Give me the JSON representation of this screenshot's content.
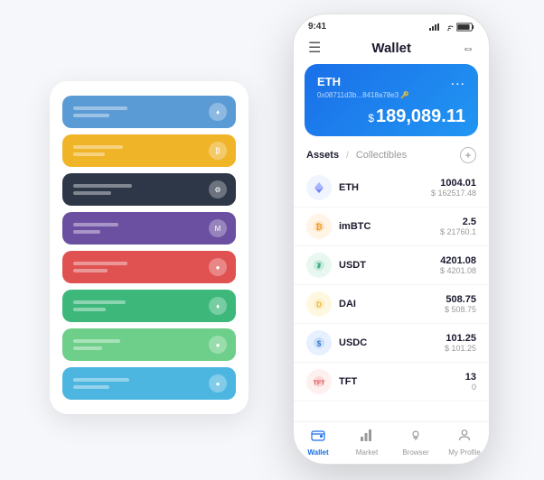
{
  "app": {
    "title": "Wallet",
    "time": "9:41"
  },
  "phone": {
    "status_bar": {
      "time": "9:41",
      "signal": "●●●",
      "wifi": "WiFi",
      "battery": "Battery"
    },
    "header": {
      "title": "Wallet",
      "menu_icon": "☰",
      "scan_icon": "⇔"
    },
    "eth_card": {
      "label": "ETH",
      "dots": "...",
      "address": "0x08711d3b...8418a78e3 🔑",
      "currency_symbol": "$",
      "balance": "189,089.11"
    },
    "assets_section": {
      "tab_active": "Assets",
      "tab_divider": "/",
      "tab_inactive": "Collectibles",
      "add_label": "+"
    },
    "assets": [
      {
        "name": "ETH",
        "icon": "♦",
        "amount": "1004.01",
        "usd": "$ 162517.48",
        "icon_class": "eth-icon"
      },
      {
        "name": "imBTC",
        "icon": "₿",
        "amount": "2.5",
        "usd": "$ 21760.1",
        "icon_class": "imbtc-icon"
      },
      {
        "name": "USDT",
        "icon": "₮",
        "amount": "4201.08",
        "usd": "$ 4201.08",
        "icon_class": "usdt-icon"
      },
      {
        "name": "DAI",
        "icon": "⬡",
        "amount": "508.75",
        "usd": "$ 508.75",
        "icon_class": "dai-icon"
      },
      {
        "name": "USDC",
        "icon": "$",
        "amount": "101.25",
        "usd": "$ 101.25",
        "icon_class": "usdc-icon"
      },
      {
        "name": "TFT",
        "icon": "🌿",
        "amount": "13",
        "usd": "0",
        "icon_class": "tft-icon"
      }
    ],
    "bottom_nav": [
      {
        "label": "Wallet",
        "icon": "◎",
        "active": true
      },
      {
        "label": "Market",
        "icon": "📊",
        "active": false
      },
      {
        "label": "Browser",
        "icon": "👤",
        "active": false
      },
      {
        "label": "My Profile",
        "icon": "👤",
        "active": false
      }
    ]
  },
  "card_stack": {
    "cards": [
      {
        "color": "card-blue",
        "dot": "♦"
      },
      {
        "color": "card-yellow",
        "dot": "₿"
      },
      {
        "color": "card-dark",
        "dot": "⚙"
      },
      {
        "color": "card-purple",
        "dot": "M"
      },
      {
        "color": "card-red",
        "dot": "●"
      },
      {
        "color": "card-green",
        "dot": "♦"
      },
      {
        "color": "card-light-green",
        "dot": "●"
      },
      {
        "color": "card-sky",
        "dot": "●"
      }
    ]
  }
}
